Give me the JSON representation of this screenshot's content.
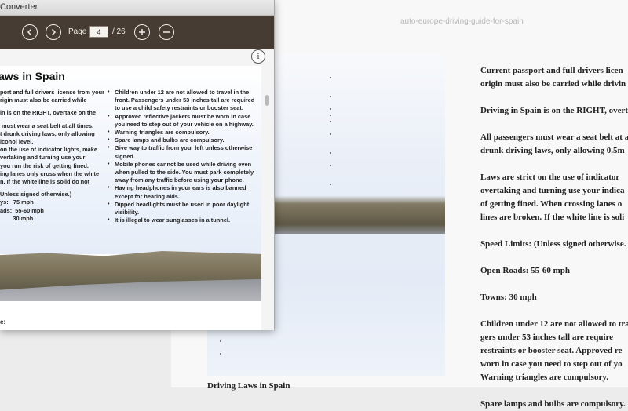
{
  "background_document": {
    "file_name": "auto-europe-driving-guide-for-spain",
    "caption": "Driving Laws in Spain",
    "paragraphs": [
      "Current passport and full drivers licen",
      "origin must also be carried while drivin",
      "",
      "Driving in Spain is on the RIGHT, overt",
      "",
      "All passengers must wear a seat belt at a",
      "drunk driving laws, only allowing 0.5m",
      "",
      "Laws are strict on the use of indicator",
      "overtaking and turning use your indica",
      "of getting fined. When crossing lanes o",
      "lines are broken. If the white line is soli",
      "",
      "Speed Limits: (Unless signed otherwise.",
      "",
      "Open Roads: 55-60 mph",
      "",
      "Towns: 30 mph",
      "",
      "Children under 12 are not allowed to tra",
      "gers under 53 inches tall are require",
      "restraints or booster seat. Approved re",
      "worn in case you need to step out of yo",
      "Warning triangles are compulsory.",
      "",
      "Spare lamps and bulbs are compulsory."
    ]
  },
  "window": {
    "title": "Converter",
    "toolbar": {
      "prev_icon": "chevron-left-icon",
      "next_icon": "chevron-right-icon",
      "page_label": "Page",
      "page_value": "4",
      "page_total": "/ 26",
      "zoom_in_icon": "plus-icon",
      "zoom_out_icon": "minus-icon"
    },
    "info_label": "i"
  },
  "preview": {
    "heading": "aws in Spain",
    "left_column": [
      "port and full drivers license from your",
      "rigin must also be carried while",
      "",
      "in is on the RIGHT, overtake on the",
      "",
      " must wear a seat belt at all times.",
      "t drunk driving laws, only allowing",
      "lcohol level.",
      "on the use of indicator lights, make",
      "vertaking and turning use your",
      "you run the risk of getting fined.",
      "ing lanes only cross when the white",
      "n. If the white line is solid do not",
      "",
      "Unless signed otherwise.)",
      "ys:   75 mph",
      "ads:  55-60 mph",
      "        30 mph"
    ],
    "right_column": [
      "Children under 12 are not allowed to travel in the front. Passengers under 53 inches tall are required to use a child safety restraints or booster seat.",
      "Approved reflective jackets must be worn in case you need to step out of your vehicle on a highway.",
      "Warning triangles are compulsory.",
      "Spare lamps and bulbs are compulsory.",
      "Give way to traffic from your left unless otherwise signed.",
      "Mobile phones cannot be used while driving even when pulled to the side. You must park completely away from any traffic before using your phone.",
      "Having headphones in your ears is also banned except for hearing aids.",
      "Dipped headlights must be used in poor daylight visibility.",
      "It is illegal to wear sunglasses in a tunnel."
    ],
    "bottom_text": "e:"
  }
}
